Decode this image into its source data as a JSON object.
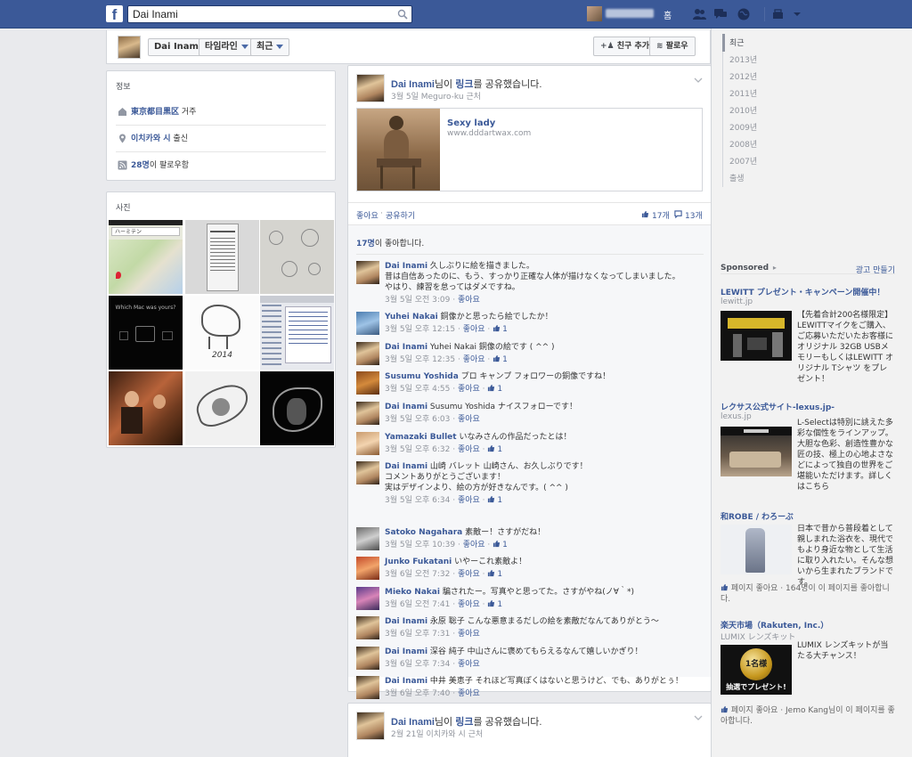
{
  "topbar": {
    "logo": "f",
    "search_value": "Dai Inami",
    "home_label": "홈"
  },
  "timeline": {
    "name_button": "Dai Inami",
    "timeline_button": "타임라인",
    "recent_button": "최근",
    "add_friend_label": "친구 추가",
    "follow_label": "팔로우"
  },
  "info": {
    "title": "정보",
    "lives_place": "東京都目黒区",
    "lives_suffix": " 거주",
    "from_place": "이치카와 시",
    "from_suffix": " 출신",
    "followers_count": "28명",
    "followers_suffix": "이 팔로우함"
  },
  "photos": {
    "title": "사진",
    "map_search": "ハーミテン",
    "mac_caption": "Which Mac was yours?",
    "year_text": "2014"
  },
  "story1": {
    "actor": "Dai Inami",
    "verb_pre": "님이 ",
    "verb_link": "링크",
    "verb_post": "를 공유했습니다.",
    "date": "3월 5일",
    "location": " Meguro-ku 근처",
    "link_title": "Sexy lady",
    "link_domain": "www.dddartwax.com",
    "like_label": "좋아요",
    "share_label": "공유하기",
    "like_count": "17개",
    "comment_count": "13개",
    "likes_summary_count": "17명",
    "likes_summary_suffix": "이 좋아합니다."
  },
  "comments": [
    {
      "name": "Dai Inami",
      "text": " 久しぶりに絵を描きました。\n昔は自信あったのに、もう、すっかり正確な人体が描けなくなってしまいました。\nやはり、練習を怠ってはダメですね。",
      "time": "3월 5일 오전 3:09",
      "like": "좋아요",
      "likes": ""
    },
    {
      "name": "Yuhei Nakai",
      "text": " 銅像かと思ったら絵でしたか！",
      "time": "3월 5일 오후 12:15",
      "like": "좋아요",
      "likes": "1"
    },
    {
      "name": "Dai Inami",
      "text": " Yuhei Nakai 銅像の絵です ( ^^ )",
      "time": "3월 5일 오후 12:35",
      "like": "좋아요",
      "likes": "1"
    },
    {
      "name": "Susumu Yoshida",
      "text": " プロ キャンプ フォロワーの銅像ですね！",
      "time": "3월 5일 오후 4:55",
      "like": "좋아요",
      "likes": "1"
    },
    {
      "name": "Dai Inami",
      "text": " Susumu Yoshida ナイスフォローです！",
      "time": "3월 5일 오후 6:03",
      "like": "좋아요",
      "likes": ""
    },
    {
      "name": "Yamazaki Bullet",
      "text": " いなみさんの作品だったとは！",
      "time": "3월 5일 오후 6:32",
      "like": "좋아요",
      "likes": "1"
    },
    {
      "name": "Dai Inami",
      "text": " 山崎 バレット 山崎さん、お久しぶりです！\nコメントありがとうございます！\n実はデザインより、絵の方が好きなんです。( ^^ )",
      "time": "3월 5일 오후 6:34",
      "like": "좋아요",
      "likes": "1"
    },
    {
      "name": "Satoko Nagahara",
      "text": " 素敵ー！さすがだね！",
      "time": "3월 5일 오후 10:39",
      "like": "좋아요",
      "likes": "1"
    },
    {
      "name": "Junko Fukatani",
      "text": " いやーこれ素敵よ！",
      "time": "3월 6일 오전 7:32",
      "like": "좋아요",
      "likes": "1"
    },
    {
      "name": "Mieko Nakai",
      "text": " 騙されたー。写真やと思ってた。さすがやね(ノ∀｀*)",
      "time": "3월 6일 오전 7:41",
      "like": "좋아요",
      "likes": "1"
    },
    {
      "name": "Dai Inami",
      "text": " 永原 聡子 こんな悪意まるだしの絵を素敵だなんてありがとう～",
      "time": "3월 6일 오후 7:31",
      "like": "좋아요",
      "likes": ""
    },
    {
      "name": "Dai Inami",
      "text": " 深谷 純子 中山さんに褒めてもらえるなんて嬉しいかぎり！",
      "time": "3월 6일 오후 7:34",
      "like": "좋아요",
      "likes": ""
    },
    {
      "name": "Dai Inami",
      "text": " 中井 美恵子 それほど写真ぽくはないと思うけど、でも、ありがとぅ！",
      "time": "3월 6일 오후 7:40",
      "like": "좋아요",
      "likes": ""
    }
  ],
  "story2": {
    "actor": "Dai Inami",
    "verb_pre": "님이 ",
    "verb_link": "링크",
    "verb_post": "를 공유했습니다.",
    "date": "2월 21일",
    "location": " 이치카와 시 근처"
  },
  "years": [
    "최근",
    "2013년",
    "2012년",
    "2011년",
    "2010년",
    "2009년",
    "2008년",
    "2007년",
    "출생"
  ],
  "ads": {
    "sponsored_label": "Sponsored",
    "create_ad_label": "광고 만들기",
    "items": [
      {
        "title": "LEWITT プレゼント・キャンペーン開催中！",
        "domain": "lewitt.jp",
        "text": "【先着合計200名様限定】LEWITTマイクをご購入、ご応募いただいたお客様にオリジナル 32GB USBメモリーもしくはLEWITT オリジナル Tシャツ をプレゼント！"
      },
      {
        "title": "レクサス公式サイト-lexus.jp-",
        "domain": "lexus.jp",
        "text": "L-Selectは特別に誂えた多彩な個性をラインアップ。大胆な色彩、創造性豊かな匠の技、極上の心地よさなどによって独自の世界をご堪能いただけます。詳しくはこちら"
      },
      {
        "title": "和ROBE / わろーぶ",
        "domain": "",
        "text": "日本で昔から普段着として親しまれた浴衣を、現代でもより身近な物として生活に取り入れたい。そんな想いから生まれたブランドです。",
        "social": "페이지 좋아요 · 164명이 이 페이지를 좋아합니다."
      },
      {
        "title": "楽天市場（Rakuten, Inc.）",
        "domain": "LUMIX レンズキット",
        "text": "LUMIX レンズキットが当たる大チャンス！",
        "img_line1": "1名様",
        "img_line2": "抽選でプレゼント!",
        "social": "페이지 좋아요 · Jemo Kang님이 이 페이지를 좋아합니다."
      }
    ]
  },
  "colors": {
    "brand": "#3b5998",
    "page_bg": "#e9eaed",
    "muted": "#90949c"
  }
}
